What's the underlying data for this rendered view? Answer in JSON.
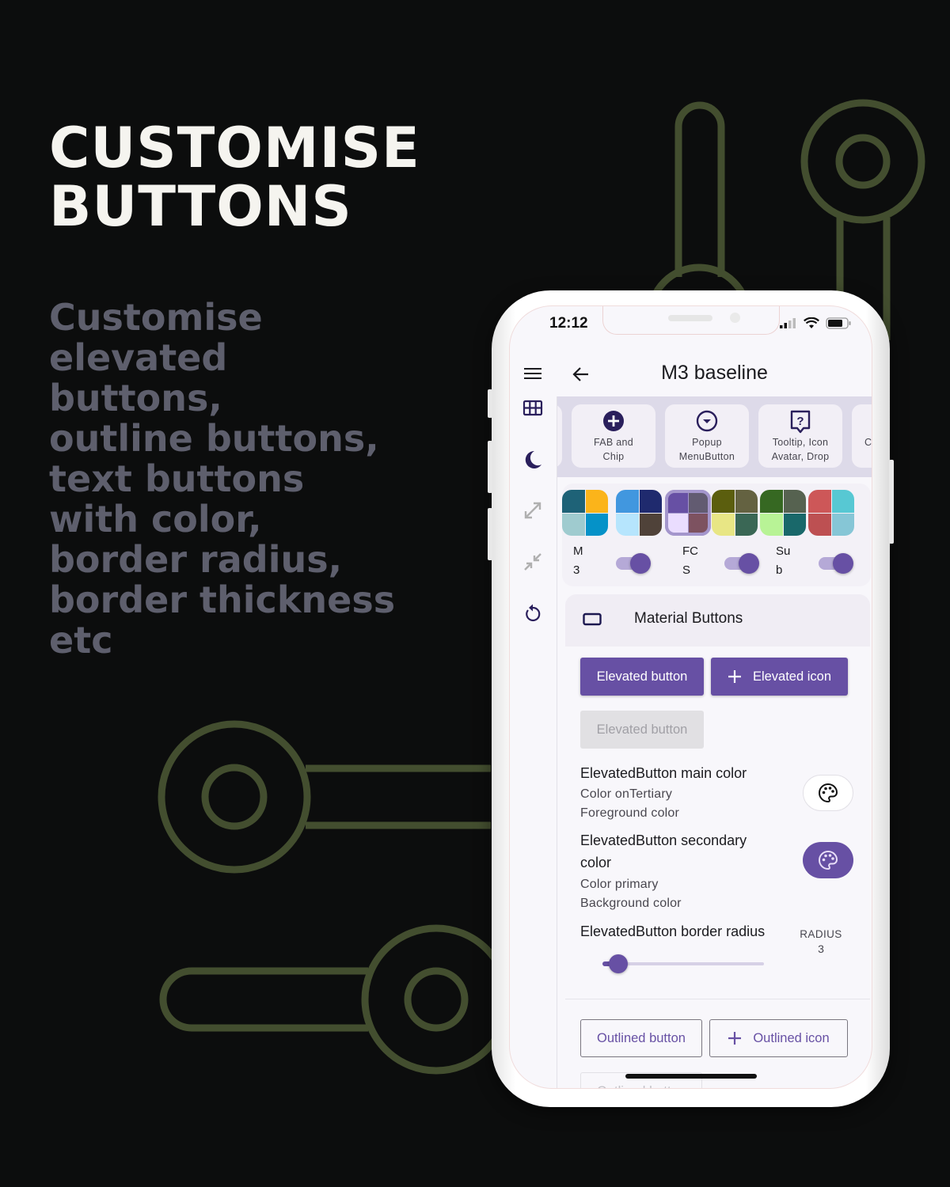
{
  "promo": {
    "headline": [
      "CUSTOMISE",
      "BUTTONS"
    ],
    "description": [
      "Customise",
      "elevated",
      "buttons,",
      "outline buttons,",
      "text buttons",
      "with color,",
      "border radius,",
      "border thickness",
      "etc"
    ],
    "colors": {
      "background": "#0c0d0d",
      "headline": "#f5f4ef",
      "description": "#5e5f6d",
      "decoration": "#434e2f"
    }
  },
  "status_bar": {
    "time": "12:12",
    "icons": [
      "signal-icon",
      "wifi-icon",
      "battery-icon"
    ]
  },
  "app_bar": {
    "title": "M3 baseline",
    "menu_icon": "menu-icon",
    "back_icon": "arrow-back-icon"
  },
  "nav_rail": {
    "items": [
      {
        "icon": "grid-view-icon",
        "enabled": true
      },
      {
        "icon": "dark-mode-icon",
        "enabled": true
      },
      {
        "icon": "expand-icon",
        "enabled": false
      },
      {
        "icon": "collapse-icon",
        "enabled": false
      },
      {
        "icon": "reset-icon",
        "enabled": true
      }
    ]
  },
  "panel_cards": [
    {
      "label": "",
      "icon": ""
    },
    {
      "label": "FAB and\nChip",
      "line1": "FAB and",
      "line2": "Chip",
      "icon": "add-circle-icon"
    },
    {
      "label": "Popup\nMenuButton",
      "line1": "Popup",
      "line2": "MenuButton",
      "icon": "arrow-drop-down-circle-icon"
    },
    {
      "label": "Tooltip, Icon\nAvatar, Drop",
      "line1": "Tooltip, Icon",
      "line2": "Avatar, Drop",
      "icon": "help-bubble-icon"
    },
    {
      "label": "C",
      "line1": "",
      "line2": "C",
      "icon": ""
    }
  ],
  "theme_swatches": [
    {
      "colors": [
        "#1e6277",
        "#fbb41a",
        "#9fcbcf",
        "#0592c8"
      ],
      "selected": false
    },
    {
      "colors": [
        "#4197df",
        "#1f2a6e",
        "#b6e5fd",
        "#4f4239"
      ],
      "selected": false
    },
    {
      "colors": [
        "#6750a4",
        "#625b71",
        "#eaddff",
        "#7d5260"
      ],
      "selected": true
    },
    {
      "colors": [
        "#5b5e0e",
        "#646241",
        "#e8e685",
        "#3a6755"
      ],
      "selected": false
    },
    {
      "colors": [
        "#366822",
        "#566250",
        "#b8f396",
        "#19686a"
      ],
      "selected": false
    },
    {
      "colors": [
        "#cd5758",
        "#57c8d3",
        "#bd5052",
        "#86c6d6"
      ],
      "selected": false
    }
  ],
  "toggles": [
    {
      "label_line1": "M",
      "label_line2": "3",
      "on": true
    },
    {
      "label_line1": "FC",
      "label_line2": "S",
      "on": true
    },
    {
      "label_line1": "Su",
      "label_line2": "b",
      "on": true
    }
  ],
  "section": {
    "title": "Material Buttons",
    "icon": "crop-landscape-icon"
  },
  "elevated_buttons": {
    "primary_label": "Elevated button",
    "icon_label": "Elevated icon",
    "icon": "add-icon",
    "disabled_label": "Elevated button"
  },
  "settings": [
    {
      "title": "ElevatedButton main color",
      "subtitle_line1": "Color onTertiary",
      "subtitle_line2": "Foreground color",
      "chip_icon": "palette-icon",
      "chip_color": "#ffffff"
    },
    {
      "title_line1": "ElevatedButton secondary",
      "title_line2": "color",
      "subtitle_line1": "Color primary",
      "subtitle_line2": "Background color",
      "chip_icon": "palette-icon",
      "chip_color": "#6750a4"
    }
  ],
  "border_radius": {
    "title": "ElevatedButton border radius",
    "value_label": "RADIUS",
    "value": "3",
    "slider_fraction": 0.1
  },
  "outlined_buttons": {
    "primary_label": "Outlined button",
    "icon_label": "Outlined icon",
    "icon": "add-icon",
    "disabled_label": "Outlined button"
  },
  "theme": {
    "primary": "#6750a4",
    "surface": "#f8f7fb",
    "on_surface": "#1b1b1f"
  }
}
